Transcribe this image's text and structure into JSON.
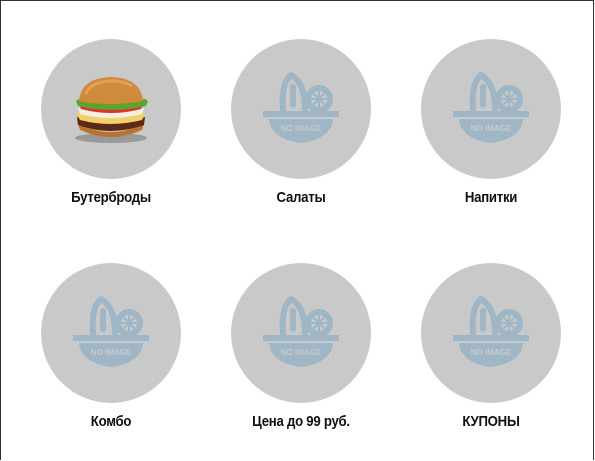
{
  "categories": [
    {
      "label": "Бутерброды",
      "icon": "burger-image"
    },
    {
      "label": "Салаты",
      "icon": "no-image-placeholder-icon",
      "placeholder_text": "NO IMAGE"
    },
    {
      "label": "Напитки",
      "icon": "no-image-placeholder-icon",
      "placeholder_text": "NO IMAGE"
    },
    {
      "label": "Комбо",
      "icon": "no-image-placeholder-icon",
      "placeholder_text": "NO IMAGE"
    },
    {
      "label": "Цена до 99 руб.",
      "icon": "no-image-placeholder-icon",
      "placeholder_text": "NO IMAGE"
    },
    {
      "label": "КУПОНЫ",
      "icon": "no-image-placeholder-icon",
      "placeholder_text": "NO IMAGE"
    }
  ],
  "colors": {
    "circle": "#c9c9c9",
    "placeholder_icon": "#9fb6c6",
    "text": "#111111"
  }
}
